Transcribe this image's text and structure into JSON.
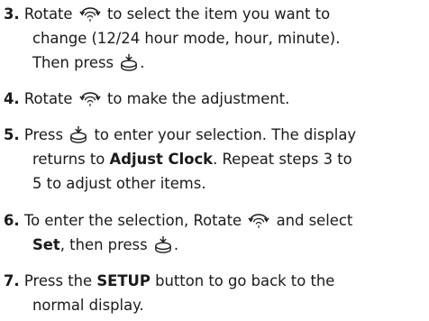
{
  "steps": [
    {
      "num": "3.",
      "l1a": "Rotate",
      "l1b": "to select the item you want to",
      "l2": "change (12/24 hour mode, hour, minute).",
      "l3": "Then press",
      "l3b": "."
    },
    {
      "num": "4.",
      "l1a": "Rotate",
      "l1b": "to make the adjustment."
    },
    {
      "num": "5.",
      "l1a": "Press",
      "l1b": "to enter your selection. The display",
      "l2a": "returns to",
      "l2kw": "Adjust Clock",
      "l2b": ". Repeat steps 3 to",
      "l3": "5 to adjust other items."
    },
    {
      "num": "6.",
      "l1a": "To enter the selection, Rotate",
      "l1b": "and select",
      "l2kw": "Set",
      "l2a": ", then press",
      "l2b": "."
    },
    {
      "num": "7.",
      "l1a": "Press the",
      "l1kw": "SETUP",
      "l1b": "button to go back to the",
      "l2": "normal display."
    }
  ],
  "icons": {
    "rotate": "rotate-dial-icon",
    "press": "press-dial-icon"
  }
}
